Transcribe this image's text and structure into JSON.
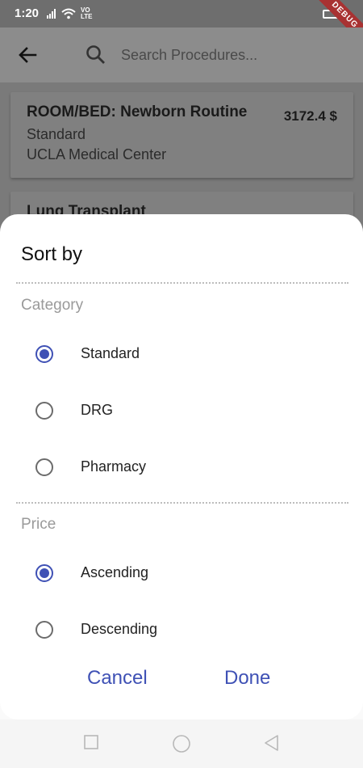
{
  "status_bar": {
    "time": "1:20",
    "network_label": "VO\nLTE",
    "debug_label": "DEBUG"
  },
  "app_bar": {
    "search_placeholder": "Search Procedures..."
  },
  "procedures": [
    {
      "title": "ROOM/BED: Newborn Routine",
      "category": "Standard",
      "provider": "UCLA Medical Center",
      "price": "3172.4 $"
    },
    {
      "title": "Lung Transplant",
      "price": "…"
    }
  ],
  "sort_sheet": {
    "title": "Sort by",
    "category_label": "Category",
    "category_options": [
      {
        "label": "Standard",
        "checked": true
      },
      {
        "label": "DRG",
        "checked": false
      },
      {
        "label": "Pharmacy",
        "checked": false
      }
    ],
    "price_label": "Price",
    "price_options": [
      {
        "label": "Ascending",
        "checked": true
      },
      {
        "label": "Descending",
        "checked": false
      }
    ],
    "cancel_label": "Cancel",
    "done_label": "Done"
  },
  "colors": {
    "accent": "#3f51b5",
    "scrim": "#7a7a7a",
    "sheet": "#ffffff"
  }
}
